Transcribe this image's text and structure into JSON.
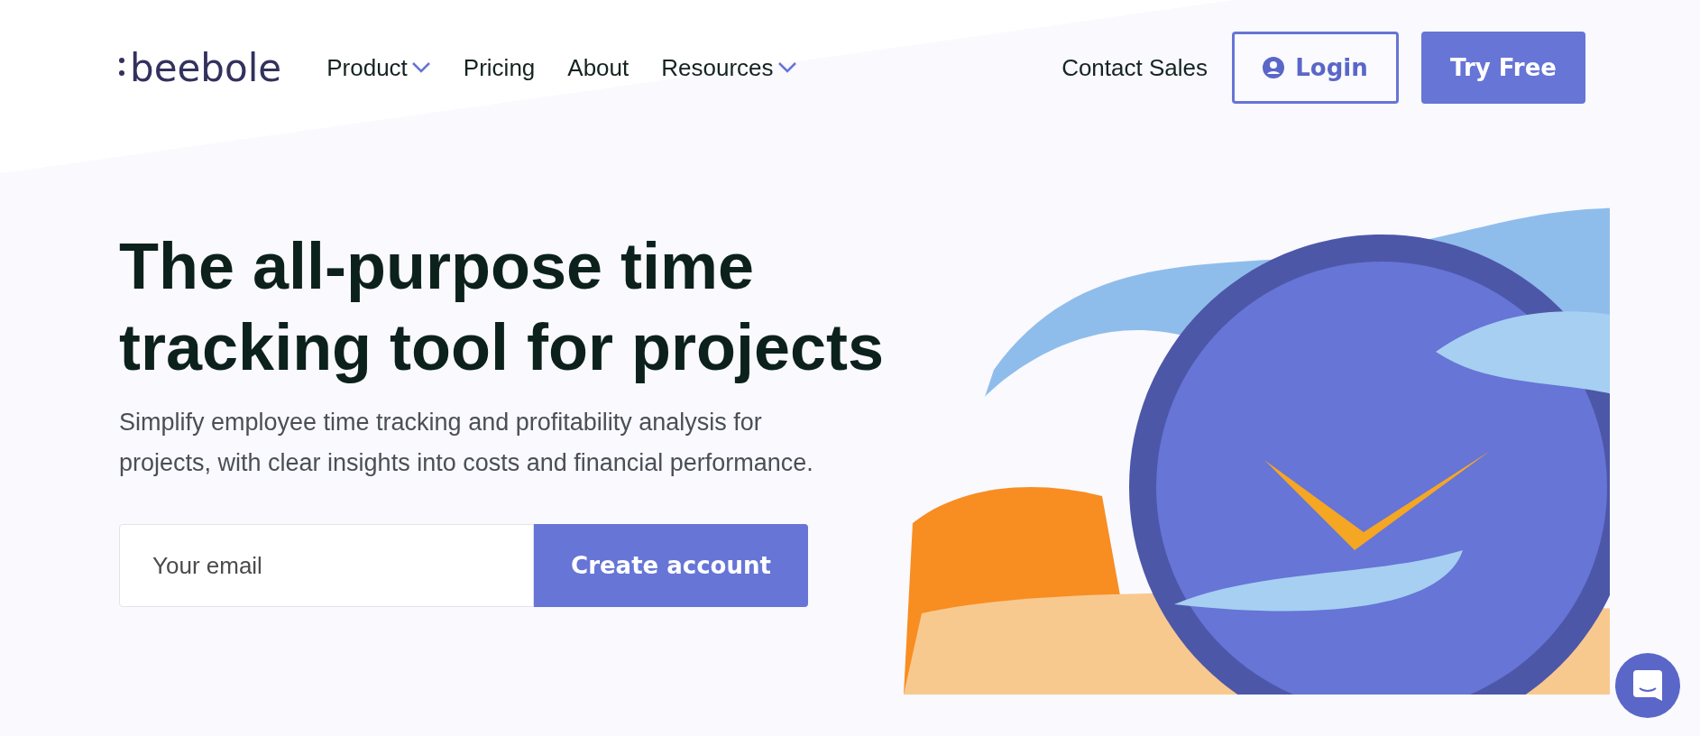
{
  "header": {
    "logo": "beebole",
    "nav": [
      {
        "label": "Product",
        "dropdown": true
      },
      {
        "label": "Pricing",
        "dropdown": false
      },
      {
        "label": "About",
        "dropdown": false
      },
      {
        "label": "Resources",
        "dropdown": true
      }
    ],
    "contact": "Contact Sales",
    "login": "Login",
    "try_free": "Try Free"
  },
  "hero": {
    "title": "The all-purpose time tracking tool for projects",
    "subtitle": "Simplify employee time tracking and profitability analysis for projects, with clear insights into costs and financial performance.",
    "email": {
      "placeholder": "Your email"
    },
    "cta": "Create account"
  }
}
